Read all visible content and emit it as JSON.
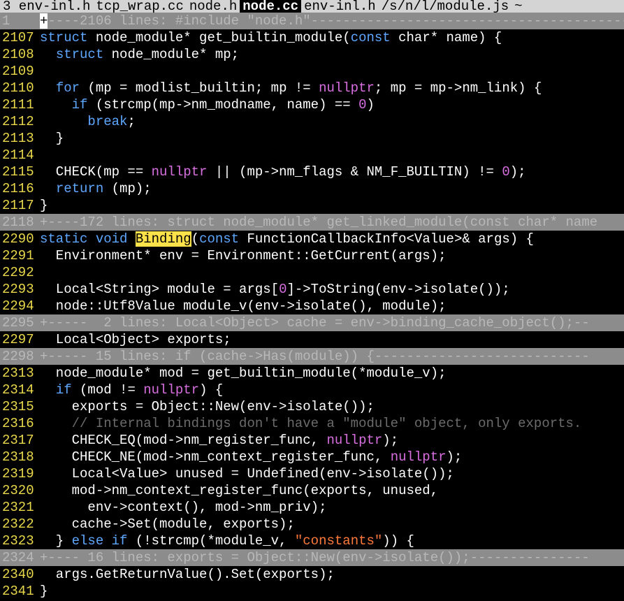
{
  "tabs": [
    {
      "label": "3 env-inl.h",
      "selected": false
    },
    {
      "label": "tcp_wrap.cc",
      "selected": false
    },
    {
      "label": "node.h",
      "selected": false
    },
    {
      "label": "node.cc",
      "selected": true
    },
    {
      "label": "env-inl.h",
      "selected": false
    },
    {
      "label": "/s/n/l/module.js",
      "selected": false
    },
    {
      "label": "~",
      "selected": false
    }
  ],
  "colors": {
    "background": "#000000",
    "line_number": "#e8d84a",
    "keyword": "#5da7ff",
    "literal": "#d86ee0",
    "string": "#ff7a3a",
    "comment": "#6b6b6b",
    "fold_bg": "#8c8c8c",
    "search_highlight": "#ffe14a"
  },
  "lines": [
    {
      "n": "1",
      "type": "fold",
      "text": "+----2106 lines: #include \"node.h\"----------------------------------------------------",
      "cursor": true
    },
    {
      "n": "2107",
      "tokens": [
        [
          "kw",
          "struct"
        ],
        [
          "",
          "node_module* get_builtin_module("
        ],
        [
          "kw",
          "const"
        ],
        [
          "",
          "char* name) {"
        ]
      ]
    },
    {
      "n": "2108",
      "tokens": [
        [
          "",
          "  "
        ],
        [
          "kw",
          "struct"
        ],
        [
          "",
          "node_module* mp;"
        ]
      ]
    },
    {
      "n": "2109",
      "tokens": []
    },
    {
      "n": "2110",
      "tokens": [
        [
          "",
          "  "
        ],
        [
          "kw",
          "for"
        ],
        [
          "",
          "(mp = modlist_builtin; mp != "
        ],
        [
          "nl",
          "nullptr"
        ],
        [
          "",
          "; mp = mp->nm_link) {"
        ]
      ]
    },
    {
      "n": "2111",
      "tokens": [
        [
          "",
          "    "
        ],
        [
          "kw",
          "if"
        ],
        [
          "",
          "(strcmp(mp->nm_modname, name) == "
        ],
        [
          "nl",
          "0"
        ],
        [
          "",
          ")"
        ]
      ]
    },
    {
      "n": "2112",
      "tokens": [
        [
          "",
          "      "
        ],
        [
          "kw",
          "break"
        ],
        [
          "",
          ";"
        ]
      ]
    },
    {
      "n": "2113",
      "tokens": [
        [
          "",
          "  }"
        ]
      ]
    },
    {
      "n": "2114",
      "tokens": []
    },
    {
      "n": "2115",
      "tokens": [
        [
          "",
          "  CHECK(mp == "
        ],
        [
          "nl",
          "nullptr"
        ],
        [
          "",
          " || (mp->nm_flags & NM_F_BUILTIN) != "
        ],
        [
          "nl",
          "0"
        ],
        [
          "",
          ");"
        ]
      ]
    },
    {
      "n": "2116",
      "tokens": [
        [
          "",
          "  "
        ],
        [
          "kw",
          "return"
        ],
        [
          "",
          "(mp);"
        ]
      ]
    },
    {
      "n": "2117",
      "tokens": [
        [
          "",
          "}"
        ]
      ]
    },
    {
      "n": "2118",
      "type": "fold",
      "text": "+----172 lines: struct node_module* get_linked_module(const char* name"
    },
    {
      "n": "2290",
      "tokens": [
        [
          "kw",
          "static"
        ],
        [
          "",
          ""
        ],
        [
          "kw",
          "void"
        ],
        [
          "",
          ""
        ],
        [
          "hl",
          "Binding"
        ],
        [
          "",
          "("
        ],
        [
          "kw",
          "const"
        ],
        [
          "",
          " FunctionCallbackInfo<Value>& args) {"
        ]
      ]
    },
    {
      "n": "2291",
      "tokens": [
        [
          "",
          "  Environment* env = Environment::GetCurrent(args);"
        ]
      ]
    },
    {
      "n": "2292",
      "tokens": []
    },
    {
      "n": "2293",
      "tokens": [
        [
          "",
          "  Local<String> module = args["
        ],
        [
          "nl",
          "0"
        ],
        [
          "",
          "]->ToString(env->isolate());"
        ]
      ]
    },
    {
      "n": "2294",
      "tokens": [
        [
          "",
          "  node::Utf8Value module_v(env->isolate(), module);"
        ]
      ]
    },
    {
      "n": "2295",
      "type": "fold",
      "text": "+-----  2 lines: Local<Object> cache = env->binding_cache_object();--"
    },
    {
      "n": "2297",
      "tokens": [
        [
          "",
          "  Local<Object> exports;"
        ]
      ]
    },
    {
      "n": "2298",
      "type": "fold",
      "text": "+----- 15 lines: if (cache->Has(module)) {---------------------------"
    },
    {
      "n": "2313",
      "tokens": [
        [
          "",
          "  node_module* mod = get_builtin_module(*module_v);"
        ]
      ]
    },
    {
      "n": "2314",
      "tokens": [
        [
          "",
          "  "
        ],
        [
          "kw",
          "if"
        ],
        [
          "",
          "(mod != "
        ],
        [
          "nl",
          "nullptr"
        ],
        [
          "",
          ") {"
        ]
      ]
    },
    {
      "n": "2315",
      "tokens": [
        [
          "",
          "    exports = Object::New(env->isolate());"
        ]
      ]
    },
    {
      "n": "2316",
      "tokens": [
        [
          "",
          "    "
        ],
        [
          "cm",
          "// Internal bindings don't have a \"module\" object, only exports."
        ]
      ]
    },
    {
      "n": "2317",
      "tokens": [
        [
          "",
          "    CHECK_EQ(mod->nm_register_func, "
        ],
        [
          "nl",
          "nullptr"
        ],
        [
          "",
          ");"
        ]
      ]
    },
    {
      "n": "2318",
      "tokens": [
        [
          "",
          "    CHECK_NE(mod->nm_context_register_func, "
        ],
        [
          "nl",
          "nullptr"
        ],
        [
          "",
          ");"
        ]
      ]
    },
    {
      "n": "2319",
      "tokens": [
        [
          "",
          "    Local<Value> unused = Undefined(env->isolate());"
        ]
      ]
    },
    {
      "n": "2320",
      "tokens": [
        [
          "",
          "    mod->nm_context_register_func(exports, unused,"
        ]
      ]
    },
    {
      "n": "2321",
      "tokens": [
        [
          "",
          "      env->context(), mod->nm_priv);"
        ]
      ]
    },
    {
      "n": "2322",
      "tokens": [
        [
          "",
          "    cache->Set(module, exports);"
        ]
      ]
    },
    {
      "n": "2323",
      "tokens": [
        [
          "",
          "  } "
        ],
        [
          "kw",
          "else if"
        ],
        [
          "",
          "(!strcmp(*module_v, "
        ],
        [
          "str",
          "\"constants\""
        ],
        [
          "",
          ")) {"
        ]
      ]
    },
    {
      "n": "2324",
      "type": "fold",
      "text": "+---- 16 lines: exports = Object::New(env->isolate());---------------"
    },
    {
      "n": "2340",
      "tokens": [
        [
          "",
          "  args.GetReturnValue().Set(exports);"
        ]
      ]
    },
    {
      "n": "2341",
      "tokens": [
        [
          "",
          "}"
        ]
      ]
    }
  ]
}
